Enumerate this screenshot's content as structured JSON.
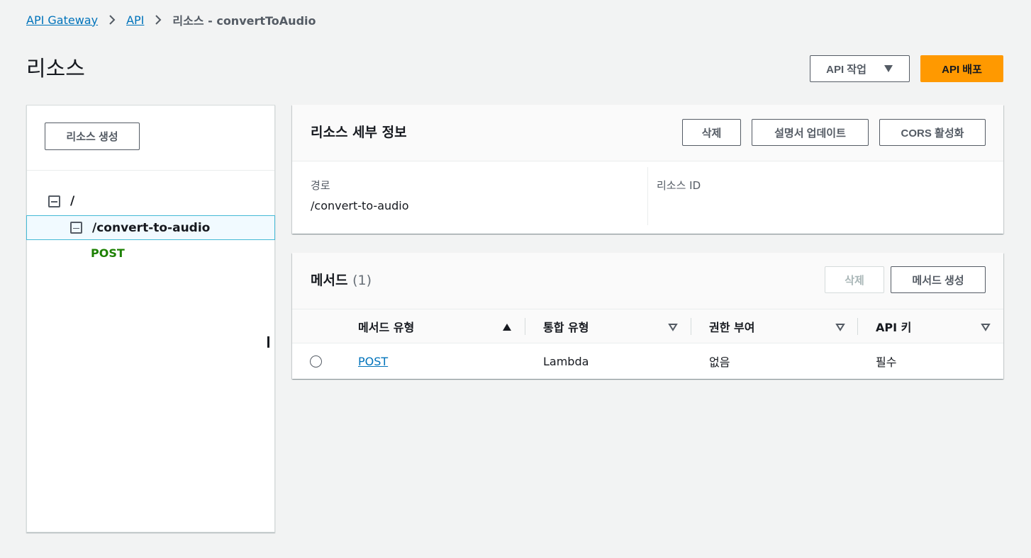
{
  "breadcrumb": {
    "items": [
      "API Gateway",
      "API"
    ],
    "current": "리소스 - convertToAudio"
  },
  "page": {
    "title": "리소스",
    "actions_label": "API 작업",
    "deploy_label": "API 배포"
  },
  "tree": {
    "create_label": "리소스 생성",
    "root": "/",
    "child": "/convert-to-audio",
    "method": "POST"
  },
  "details": {
    "title": "리소스 세부 정보",
    "delete_label": "삭제",
    "update_doc_label": "설명서 업데이트",
    "cors_label": "CORS 활성화",
    "path_label": "경로",
    "path_value": "/convert-to-audio",
    "id_label": "리소스 ID",
    "id_value": ""
  },
  "methods": {
    "title": "메서드",
    "count": "(1)",
    "delete_label": "삭제",
    "create_label": "메서드 생성",
    "columns": [
      "메서드 유형",
      "통합 유형",
      "권한 부여",
      "API 키"
    ],
    "rows": [
      {
        "method": "POST",
        "integration": "Lambda",
        "authorization": "없음",
        "api_key": "필수"
      }
    ]
  }
}
